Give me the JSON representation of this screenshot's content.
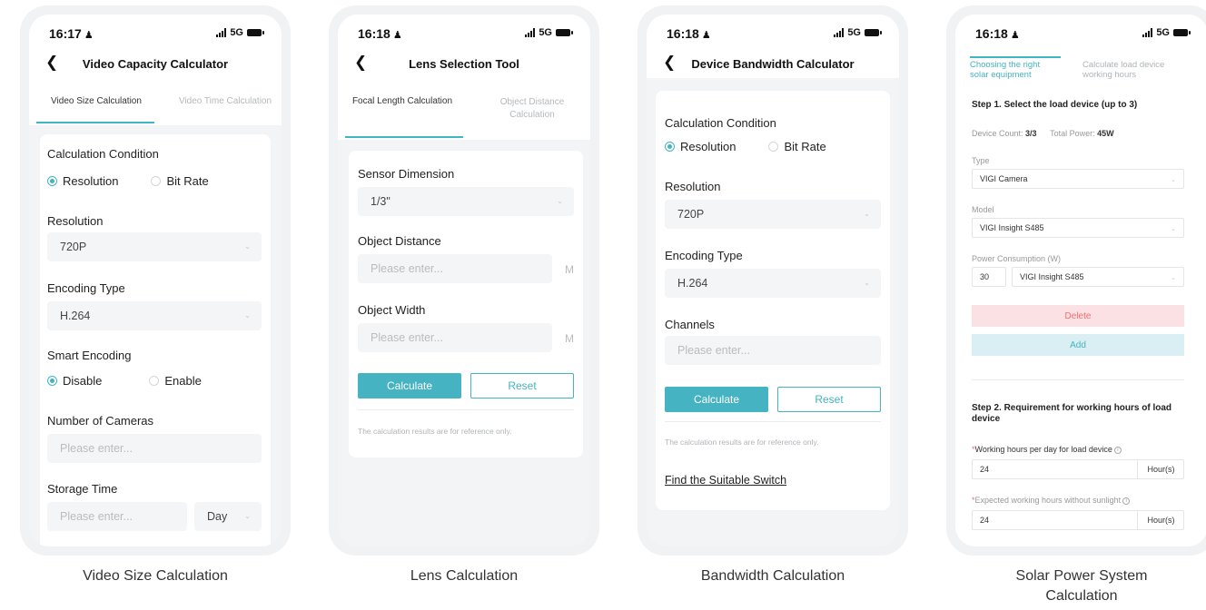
{
  "status": {
    "time1": "16:17",
    "time2": "16:18",
    "network": "5G"
  },
  "phone1": {
    "title": "Video Capacity Calculator",
    "tab_active": "Video Size Calculation",
    "tab_inactive": "Video Time Calculation",
    "calc_condition": "Calculation Condition",
    "opt_resolution": "Resolution",
    "opt_bitrate": "Bit Rate",
    "resolution_label": "Resolution",
    "resolution_value": "720P",
    "encoding_label": "Encoding Type",
    "encoding_value": "H.264",
    "smart_label": "Smart Encoding",
    "opt_disable": "Disable",
    "opt_enable": "Enable",
    "cameras_label": "Number of Cameras",
    "cameras_placeholder": "Please enter...",
    "storage_label": "Storage Time",
    "storage_placeholder": "Please enter...",
    "storage_unit": "Day"
  },
  "phone2": {
    "title": "Lens Selection Tool",
    "tab_active": "Focal Length Calculation",
    "tab_inactive_1": "Object Distance",
    "tab_inactive_2": "Calculation",
    "sensor_label": "Sensor Dimension",
    "sensor_value": "1/3\"",
    "distance_label": "Object Distance",
    "distance_placeholder": "Please enter...",
    "distance_unit": "M",
    "width_label": "Object Width",
    "width_placeholder": "Please enter...",
    "width_unit": "M",
    "calculate": "Calculate",
    "reset": "Reset",
    "note": "The calculation results are for reference only."
  },
  "phone3": {
    "title": "Device Bandwidth Calculator",
    "calc_condition": "Calculation Condition",
    "opt_resolution": "Resolution",
    "opt_bitrate": "Bit Rate",
    "resolution_label": "Resolution",
    "resolution_value": "720P",
    "encoding_label": "Encoding Type",
    "encoding_value": "H.264",
    "channels_label": "Channels",
    "channels_placeholder": "Please enter...",
    "calculate": "Calculate",
    "reset": "Reset",
    "note": "The calculation results are for reference only.",
    "link": "Find the Suitable Switch"
  },
  "phone4": {
    "tab_active_1": "Choosing the right",
    "tab_active_2": "solar equipment",
    "tab_inactive_1": "Calculate load device",
    "tab_inactive_2": "working hours",
    "step1": "Step 1. Select the load device (up to 3)",
    "device_count_label": "Device Count:",
    "device_count_value": "3/3",
    "total_power_label": "Total Power:",
    "total_power_value": "45W",
    "type_label": "Type",
    "type_value": "VIGI Camera",
    "model_label": "Model",
    "model_value": "VIGI Insight S485",
    "power_label": "Power Consumption (W)",
    "power_value": "30",
    "power_model": "VIGI Insight S485",
    "delete": "Delete",
    "add": "Add",
    "step2_1": "Step 2. Requirement for working hours of load",
    "step2_2": "device",
    "hours_day_label": "Working hours per day for load device",
    "hours_day_value": "24",
    "hours_unit": "Hour(s)",
    "hours_sun_label": "Expected working hours without sunlight",
    "hours_sun_value": "24",
    "hours_unit2": "Hour(s)"
  },
  "captions": {
    "c1": "Video Size  Calculation",
    "c2": "Lens Calculation",
    "c3": "Bandwidth Calculation",
    "c4_1": "Solar Power System",
    "c4_2": "Calculation"
  },
  "colors": {
    "accent": "#45b3c1",
    "delete_bg": "#fbe1e3",
    "add_bg": "#d9eff3"
  }
}
